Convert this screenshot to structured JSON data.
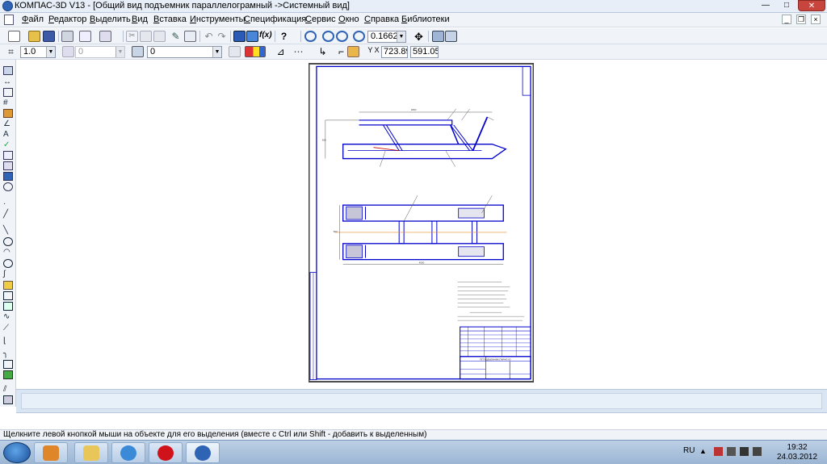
{
  "window": {
    "title": "КОМПАС-3D V13 - [Общий вид подъемник параллелограмный ->Системный вид]",
    "minimize": "—",
    "maximize": "□",
    "close": "✕"
  },
  "menu": {
    "items": [
      "Файл",
      "Редактор",
      "Выделить",
      "Вид",
      "Вставка",
      "Инструменты",
      "Спецификация",
      "Сервис",
      "Окно",
      "Справка",
      "Библиотеки"
    ]
  },
  "toolbar1": {
    "zoom_value": "0.1662"
  },
  "toolbar2": {
    "scale_value": "1.0",
    "layer_value": "0",
    "style_value": "0",
    "coord_x": "723.89",
    "coord_y": "591.05"
  },
  "drawing": {
    "dim_top": "1800",
    "dim_side": "810",
    "dim_bottom": "4500",
    "dim_left_small": "600",
    "title_block_text": "ПГ.ПОДЪЕМНИК.ПАРАЛ.00"
  },
  "statusbar": {
    "hint": "Щелкните левой кнопкой мыши на объекте для его выделения (вместе с Ctrl или Shift - добавить к выделенным)"
  },
  "taskbar": {
    "lang": "RU",
    "time": "19:32",
    "date": "24.03.2012"
  },
  "colors": {
    "drawing_line": "#0000cc",
    "accent_blue": "#2f63b4",
    "close_red": "#c7453c"
  }
}
